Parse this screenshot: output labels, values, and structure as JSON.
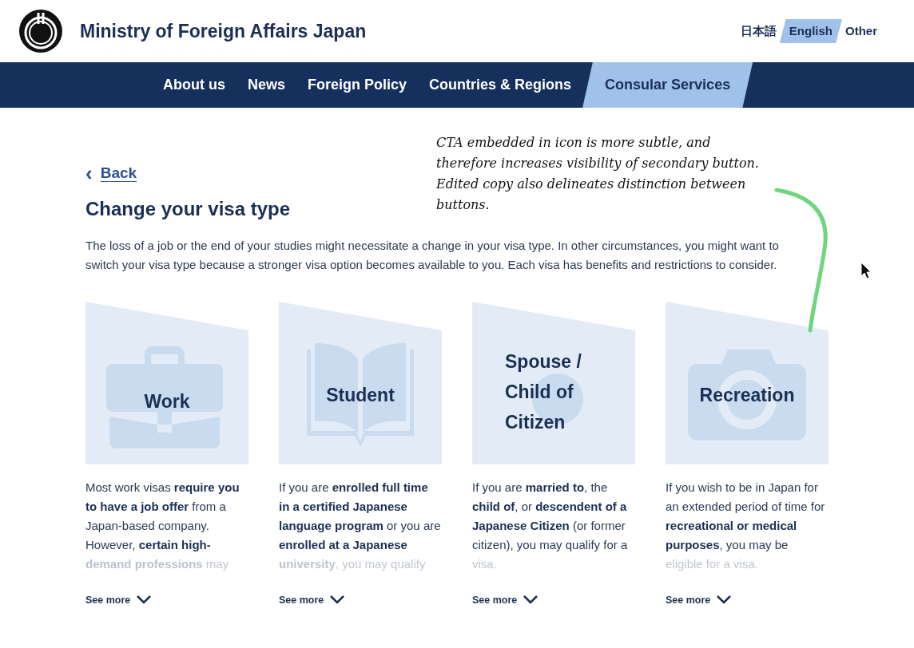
{
  "header": {
    "title": "Ministry of Foreign Affairs Japan",
    "languages": [
      {
        "label": "日本語",
        "selected": false
      },
      {
        "label": "English",
        "selected": true
      },
      {
        "label": "Other",
        "selected": false
      }
    ]
  },
  "nav": [
    {
      "label": "About us",
      "selected": false
    },
    {
      "label": "News",
      "selected": false
    },
    {
      "label": "Foreign Policy",
      "selected": false
    },
    {
      "label": "Countries & Regions",
      "selected": false
    },
    {
      "label": "Consular Services",
      "selected": true
    }
  ],
  "back": {
    "icon": "‹",
    "label": "Back"
  },
  "heading": "Change your visa type",
  "intro": "The loss of a job or the end of your studies might necessitate a change in your visa type. In other circumstances, you might want to switch your visa type because a stronger visa option becomes available to you. Each visa has benefits and restrictions to consider.",
  "cards": [
    {
      "kind": "briefcase",
      "title": "Work",
      "description": "Most work visas **require you to have a job offer** from a Japan-based company. However, **certain high-demand professions** may",
      "link": "See more"
    },
    {
      "kind": "book",
      "title": "Student",
      "description": "If you are **enrolled full time in a certified Japanese language program** or you are **enrolled at a Japanese university**, you may qualify",
      "link": "See more"
    },
    {
      "kind": "person",
      "title": "Spouse / Child of Citizen",
      "description": "If you are **married to**, the **child of**, or **descendent of a Japanese Citizen** (or former citizen), you may qualify for a visa.",
      "link": "See more"
    },
    {
      "kind": "camera",
      "title": "Recreation",
      "description": "If you wish to be in Japan for an extended period of time for **recreational or medical purposes**, you may be eligible for a visa.",
      "link": "See more"
    }
  ],
  "annotation": "CTA embedded in icon is more subtle, and therefore increases visibility of secondary button. Edited copy also delineates distinction between buttons."
}
